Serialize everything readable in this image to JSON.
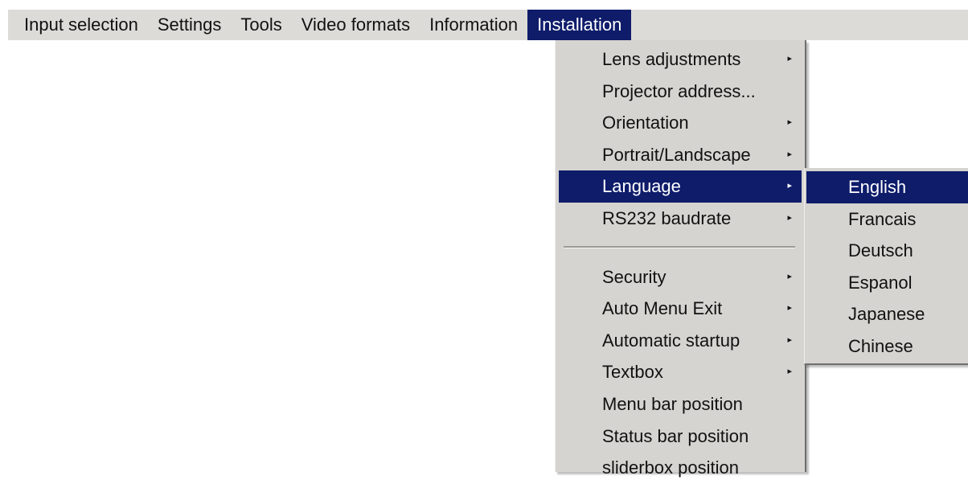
{
  "menubar": {
    "items": [
      {
        "label": "Input selection"
      },
      {
        "label": "Settings"
      },
      {
        "label": "Tools"
      },
      {
        "label": "Video formats"
      },
      {
        "label": "Information"
      },
      {
        "label": "Installation",
        "active": true
      }
    ]
  },
  "installation_menu": {
    "group1": [
      {
        "label": "Lens adjustments",
        "submenu": true
      },
      {
        "label": "Projector address...",
        "submenu": false
      },
      {
        "label": "Orientation",
        "submenu": true
      },
      {
        "label": "Portrait/Landscape",
        "submenu": true
      },
      {
        "label": "Language",
        "submenu": true,
        "selected": true
      },
      {
        "label": "RS232 baudrate",
        "submenu": true
      }
    ],
    "group2": [
      {
        "label": "Security",
        "submenu": true
      },
      {
        "label": "Auto Menu Exit",
        "submenu": true
      },
      {
        "label": "Automatic startup",
        "submenu": true
      },
      {
        "label": "Textbox",
        "submenu": true
      },
      {
        "label": "Menu bar position",
        "submenu": false
      },
      {
        "label": "Status bar position",
        "submenu": false
      },
      {
        "label": "sliderbox position",
        "submenu": false
      }
    ],
    "submenu_arrow": "▸"
  },
  "language_menu": {
    "items": [
      {
        "label": "English",
        "selected": true
      },
      {
        "label": "Francais"
      },
      {
        "label": "Deutsch"
      },
      {
        "label": "Espanol"
      },
      {
        "label": "Japanese"
      },
      {
        "label": "Chinese"
      }
    ]
  },
  "colors": {
    "menu_background": "#d6d4d0",
    "menubar_background": "#dddbd7",
    "highlight": "#0e1c6a",
    "highlight_text": "#ffffff"
  }
}
